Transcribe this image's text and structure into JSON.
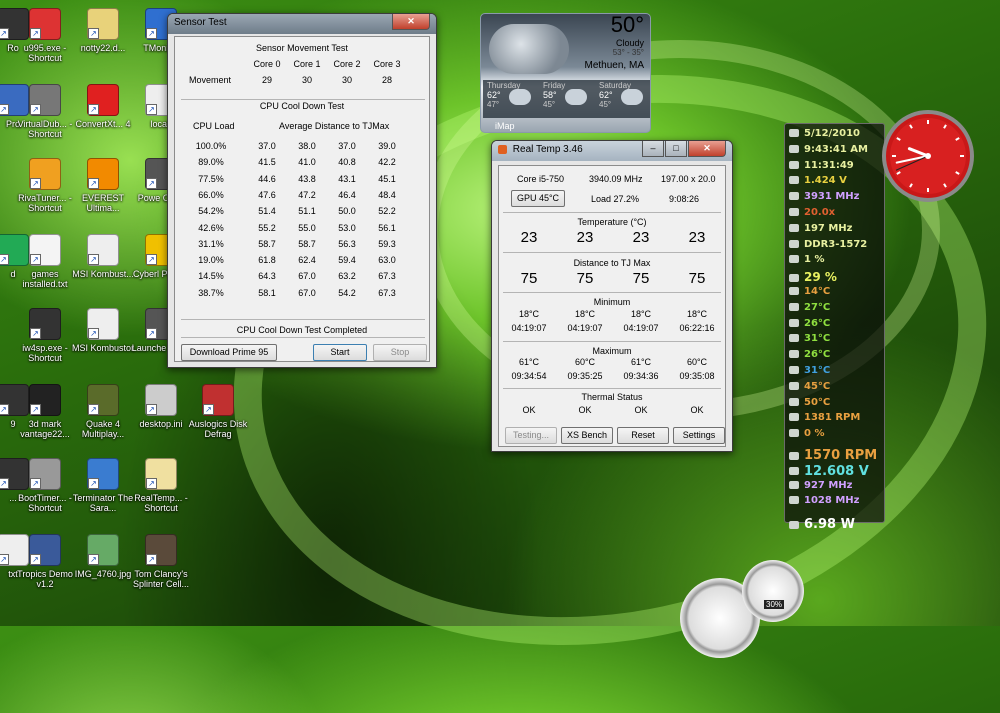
{
  "desktop": {
    "icons": [
      {
        "id": "u995",
        "label": "u995.exe - Shortcut",
        "color": "#d33"
      },
      {
        "id": "notty",
        "label": "notty22.d...",
        "color": "#e8d27a"
      },
      {
        "id": "tmonitor",
        "label": "TMonitor",
        "color": "#2f6fd0"
      },
      {
        "id": "pro",
        "label": "Pro",
        "color": "#3a6bc0"
      },
      {
        "id": "virtualdub",
        "label": "VirtualDub... - Shortcut",
        "color": "#777"
      },
      {
        "id": "convertxt",
        "label": "ConvertXt... 4",
        "color": "#e02020"
      },
      {
        "id": "local",
        "label": "local.",
        "color": "#eee"
      },
      {
        "id": "rivatuner",
        "label": "RivaTuner... - Shortcut",
        "color": "#f0a020"
      },
      {
        "id": "everest",
        "label": "EVEREST Ultima...",
        "color": "#f28a00"
      },
      {
        "id": "power",
        "label": "Powe Optio",
        "color": "#555"
      },
      {
        "id": "d",
        "label": "d",
        "color": "#2a5"
      },
      {
        "id": "games",
        "label": "games installed.txt",
        "color": "#f4f4f4"
      },
      {
        "id": "msikombust",
        "label": "MSI Kombust...",
        "color": "#eee"
      },
      {
        "id": "cyberl",
        "label": "Cyberl Powerl",
        "color": "#f0c000"
      },
      {
        "id": "iw4sp",
        "label": "iw4sp.exe - Shortcut",
        "color": "#333"
      },
      {
        "id": "msikombustor",
        "label": "MSI Kombustor",
        "color": "#eee"
      },
      {
        "id": "launcher",
        "label": "Launche Short",
        "color": "#555"
      },
      {
        "id": "3dmark",
        "label": "3d mark vantage22...",
        "color": "#222"
      },
      {
        "id": "quake4",
        "label": "Quake 4 Multiplay...",
        "color": "#5a6b2a"
      },
      {
        "id": "desktopini",
        "label": "desktop.ini",
        "color": "#ccc"
      },
      {
        "id": "auslogics",
        "label": "Auslogics Disk Defrag",
        "color": "#c03030"
      },
      {
        "id": "boottimer",
        "label": "BootTimer... - Shortcut",
        "color": "#999"
      },
      {
        "id": "terminator",
        "label": "Terminator The Sara...",
        "color": "#3a7cd0"
      },
      {
        "id": "realtemp",
        "label": "RealTemp... - Shortcut",
        "color": "#f0e0a0"
      },
      {
        "id": "txt",
        "label": "txt",
        "color": "#eee"
      },
      {
        "id": "tropics",
        "label": "Tropics Demo v1.2",
        "color": "#3a5a9a"
      },
      {
        "id": "img4760",
        "label": "IMG_4760.jpg",
        "color": "#6a6"
      },
      {
        "id": "tomclancy",
        "label": "Tom Clancy's Splinter Cell...",
        "color": "#5a4a3a"
      },
      {
        "id": "left_ro",
        "label": "Ro",
        "color": "#333"
      },
      {
        "id": "left_9",
        "label": "9",
        "color": "#333"
      },
      {
        "id": "left_bad",
        "label": "...",
        "color": "#333"
      }
    ]
  },
  "sensor_test": {
    "title": "Sensor Test",
    "movement_header": "Sensor Movement Test",
    "cores": [
      "Core 0",
      "Core 1",
      "Core 2",
      "Core 3"
    ],
    "movement_label": "Movement",
    "movement_values": [
      "29",
      "30",
      "30",
      "28"
    ],
    "cooldown_header": "CPU Cool Down Test",
    "cpu_load_header": "CPU Load",
    "avg_distance_header": "Average Distance to TJMax",
    "rows": [
      [
        "100.0%",
        "37.0",
        "38.0",
        "37.0",
        "39.0"
      ],
      [
        "89.0%",
        "41.5",
        "41.0",
        "40.8",
        "42.2"
      ],
      [
        "77.5%",
        "44.6",
        "43.8",
        "43.1",
        "45.1"
      ],
      [
        "66.0%",
        "47.6",
        "47.2",
        "46.4",
        "48.4"
      ],
      [
        "54.2%",
        "51.4",
        "51.1",
        "50.0",
        "52.2"
      ],
      [
        "42.6%",
        "55.2",
        "55.0",
        "53.0",
        "56.1"
      ],
      [
        "31.1%",
        "58.7",
        "58.7",
        "56.3",
        "59.3"
      ],
      [
        "19.0%",
        "61.8",
        "62.4",
        "59.4",
        "63.0"
      ],
      [
        "14.5%",
        "64.3",
        "67.0",
        "63.2",
        "67.3"
      ],
      [
        "38.7%",
        "58.1",
        "67.0",
        "54.2",
        "67.3"
      ]
    ],
    "status": "CPU Cool Down Test Completed",
    "buttons": {
      "download": "Download Prime 95",
      "start": "Start",
      "stop": "Stop"
    },
    "close_glyph": "✕"
  },
  "weather": {
    "temp": "50°",
    "condition": "Cloudy",
    "range": "53° - 35°",
    "location": "Methuen, MA",
    "forecast": [
      {
        "day": "Thursday",
        "high": "62°",
        "low": "47°"
      },
      {
        "day": "Friday",
        "high": "58°",
        "low": "45°"
      },
      {
        "day": "Saturday",
        "high": "62°",
        "low": "45°"
      }
    ],
    "source": "iMap"
  },
  "real_temp": {
    "title": "Real Temp 3.46",
    "cpu": "Core i5-750",
    "mhz": "3940.09 MHz",
    "multiplier": "197.00 x 20.0",
    "gpu_button": "GPU  45°C",
    "load": "Load  27.2%",
    "time": "9:08:26",
    "temperature_header": "Temperature (°C)",
    "temperatures": [
      "23",
      "23",
      "23",
      "23"
    ],
    "distance_header": "Distance to TJ Max",
    "distances": [
      "75",
      "75",
      "75",
      "75"
    ],
    "minimum_header": "Minimum",
    "minimum_temps": [
      "18°C",
      "18°C",
      "18°C",
      "18°C"
    ],
    "minimum_times": [
      "04:19:07",
      "04:19:07",
      "04:19:07",
      "06:22:16"
    ],
    "maximum_header": "Maximum",
    "maximum_temps": [
      "61°C",
      "60°C",
      "61°C",
      "60°C"
    ],
    "maximum_times": [
      "09:34:54",
      "09:35:25",
      "09:34:36",
      "09:35:08"
    ],
    "thermal_header": "Thermal Status",
    "thermal": [
      "OK",
      "OK",
      "OK",
      "OK"
    ],
    "buttons": {
      "testing": "Testing...",
      "xsbench": "XS Bench",
      "reset": "Reset",
      "settings": "Settings"
    }
  },
  "sysinfo_gadget": {
    "rows": [
      {
        "text": "5/12/2010",
        "color": "#e8f0a0"
      },
      {
        "text": "9:43:41 AM",
        "color": "#e8f0a0"
      },
      {
        "text": "11:31:49",
        "color": "#e8f0a0"
      },
      {
        "text": "1.424 V",
        "color": "#e8d040"
      },
      {
        "text": "3931 MHz",
        "color": "#d0a0ff"
      },
      {
        "text": "20.0x",
        "color": "#e06030"
      },
      {
        "text": "197 MHz",
        "color": "#e8f0a0"
      },
      {
        "text": "DDR3-1572",
        "color": "#e8f0a0"
      },
      {
        "text": "1 %",
        "color": "#e8f0a0"
      },
      {
        "text": "29 %",
        "color": "#e8f060"
      },
      {
        "text": "14°C",
        "color": "#e8a040"
      },
      {
        "text": "27°C",
        "color": "#90e040"
      },
      {
        "text": "26°C",
        "color": "#90e040"
      },
      {
        "text": "31°C",
        "color": "#90e040"
      },
      {
        "text": "26°C",
        "color": "#90e040"
      },
      {
        "text": "31°C",
        "color": "#40a0e0"
      },
      {
        "text": "45°C",
        "color": "#e8a040"
      },
      {
        "text": "50°C",
        "color": "#e8a040"
      },
      {
        "text": "1381 RPM",
        "color": "#e8a040"
      },
      {
        "text": "0 %",
        "color": "#e8a040"
      },
      {
        "text": "1570 RPM",
        "color": "#e8a040"
      },
      {
        "text": "12.608 V",
        "color": "#60e0e0"
      },
      {
        "text": "927 MHz",
        "color": "#d0a0ff"
      },
      {
        "text": "1028 MHz",
        "color": "#d0a0ff"
      },
      {
        "text": "6.98 W",
        "color": "#ffffff"
      }
    ]
  },
  "clock_gadget": {
    "hour": 9,
    "minute": 43,
    "second": 41
  },
  "meter_gadget": {
    "cpu_percent": "30%",
    "cpu_level": 0.3,
    "mem_level": 0.55
  }
}
